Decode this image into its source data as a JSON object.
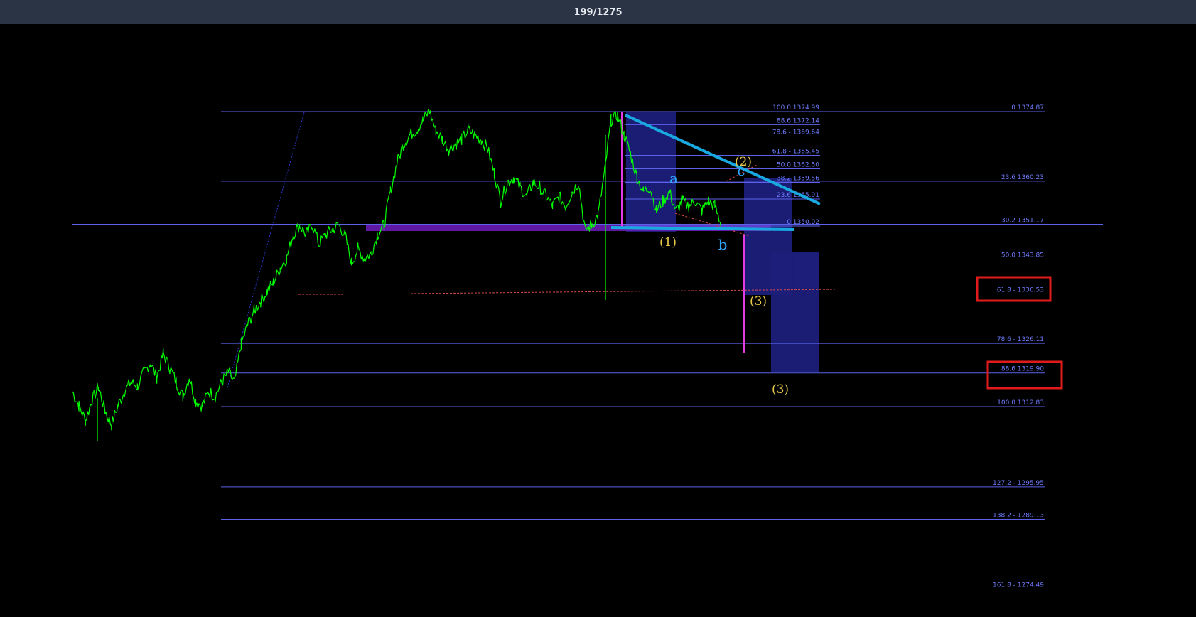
{
  "header": {
    "counter": "199/1275"
  },
  "chart_data": {
    "type": "line",
    "title": "",
    "colors": {
      "background": "#000000",
      "price": "#00ff00",
      "fib_line": "#5b62e8",
      "fib_text": "#6f7dff",
      "zone": "#1c1f7a",
      "trendline": "#18a9e0",
      "highlight_box": "#e11b1b",
      "magenta": "#e23be2",
      "dashed_red": "#d84a4a",
      "purple_band": "#6a1bb5"
    },
    "fib_levels_major": [
      {
        "label": "0 1374.87",
        "price": 1374.87
      },
      {
        "label": "23.6 1360.23",
        "price": 1360.23
      },
      {
        "label": "30.2 1351.17",
        "price": 1351.17
      },
      {
        "label": "50.0 1343.85",
        "price": 1343.85
      },
      {
        "label": "61.8 - 1336.53",
        "price": 1336.53,
        "highlighted": true
      },
      {
        "label": "78.6 - 1326.11",
        "price": 1326.11
      },
      {
        "label": "88.6 1319.90",
        "price": 1319.9,
        "highlighted": true
      },
      {
        "label": "100.0 1312.83",
        "price": 1312.83
      },
      {
        "label": "127.2 - 1295.95",
        "price": 1295.95
      },
      {
        "label": "138.2 - 1289.13",
        "price": 1289.13
      },
      {
        "label": "161.8 - 1274.49",
        "price": 1274.49
      }
    ],
    "fib_levels_minor": [
      {
        "label": "100.0 1374.99",
        "price": 1374.99
      },
      {
        "label": "88.6 1372.14",
        "price": 1372.14
      },
      {
        "label": "78.6 - 1369.64",
        "price": 1369.64
      },
      {
        "label": "61.8 - 1365.45",
        "price": 1365.45
      },
      {
        "label": "50.0 1362.50",
        "price": 1362.5
      },
      {
        "label": "38.2 1359.56",
        "price": 1359.56
      },
      {
        "label": "23.6 1355.91",
        "price": 1355.91
      },
      {
        "label": "0 1350.02",
        "price": 1350.02
      }
    ],
    "wave_labels": [
      {
        "text": "(1)",
        "color": "yellow"
      },
      {
        "text": "(2)",
        "color": "yellow"
      },
      {
        "text": "(3)",
        "color": "yellow"
      },
      {
        "text": "(3)",
        "color": "yellow"
      },
      {
        "text": "a",
        "color": "blue"
      },
      {
        "text": "b",
        "color": "blue"
      },
      {
        "text": "c",
        "color": "blue"
      }
    ],
    "price_path": [
      1316,
      1313,
      1310,
      1314,
      1317,
      1312,
      1309,
      1313,
      1316,
      1318,
      1317,
      1320,
      1322,
      1319,
      1324,
      1321,
      1318,
      1315,
      1319,
      1314,
      1313,
      1316,
      1315,
      1318,
      1320,
      1318,
      1326,
      1330,
      1333,
      1335,
      1337,
      1339,
      1342,
      1344,
      1349,
      1351,
      1349,
      1351,
      1347,
      1349,
      1350,
      1351,
      1349,
      1343,
      1346,
      1344,
      1345,
      1349,
      1351,
      1358,
      1364,
      1368,
      1370,
      1371,
      1373,
      1375,
      1371,
      1369,
      1367,
      1368,
      1369,
      1371,
      1370,
      1369,
      1367,
      1362,
      1356,
      1360,
      1361,
      1359,
      1357,
      1360,
      1359,
      1357,
      1355,
      1357,
      1355,
      1358,
      1360,
      1350,
      1351,
      1353,
      1362,
      1373,
      1374,
      1370,
      1366,
      1361,
      1358,
      1359,
      1354,
      1356,
      1358,
      1354,
      1356,
      1355,
      1356,
      1354,
      1356,
      1355,
      1351
    ]
  }
}
